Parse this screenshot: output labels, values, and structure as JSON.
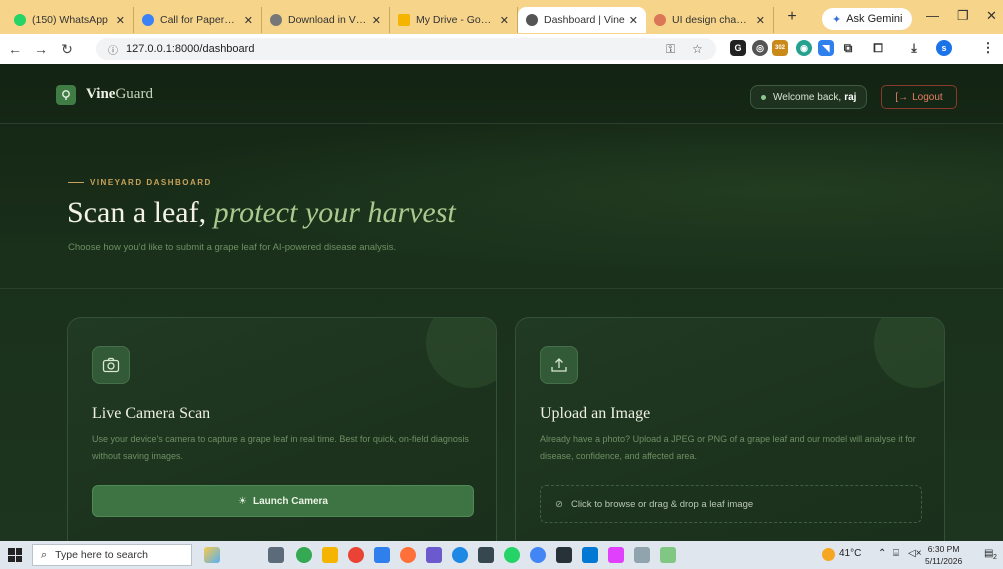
{
  "browser": {
    "tabs": [
      {
        "label": "(150) WhatsApp",
        "icon": "whatsapp-icon",
        "color": "#25d366"
      },
      {
        "label": "Call for Papers in",
        "icon": "site-icon",
        "color": "#3b82f6"
      },
      {
        "label": "Download in VS C",
        "icon": "chrome-icon",
        "color": "#777777"
      },
      {
        "label": "My Drive - Google",
        "icon": "drive-icon",
        "color": "#f4b400"
      },
      {
        "label": "Dashboard | Vine",
        "icon": "globe-icon",
        "color": "#555555"
      },
      {
        "label": "UI design change",
        "icon": "claude-icon",
        "color": "#d97757"
      }
    ],
    "active_tab": 4,
    "new_tab": "+",
    "gemini_label": "Ask Gemini",
    "url": "127.0.0.1:8000/dashboard",
    "download_badge": "302"
  },
  "nav": {
    "brand_bold": "Vine",
    "brand_rest": "Guard",
    "welcome_prefix": "Welcome back,",
    "username": "raj",
    "logout_label": "Logout"
  },
  "hero": {
    "eyebrow": "VINEYARD DASHBOARD",
    "title_plain": "Scan a leaf, ",
    "title_italic": "protect your harvest",
    "subtitle": "Choose how you'd like to submit a grape leaf for AI-powered disease analysis."
  },
  "cards": {
    "camera": {
      "title": "Live Camera Scan",
      "description": "Use your device's camera to capture a grape leaf in real time. Best for quick, on-field diagnosis without saving images.",
      "button": "Launch Camera"
    },
    "upload": {
      "title": "Upload an Image",
      "description": "Already have a photo? Upload a JPEG or PNG of a grape leaf and our model will analyse it for disease, confidence, and affected area.",
      "dropzone": "Click to browse or drag & drop a leaf image"
    }
  },
  "taskbar": {
    "search_placeholder": "Type here to search",
    "temperature": "41°C",
    "time": "6:30 PM",
    "date": "5/11/2026",
    "notification_count": "2"
  }
}
